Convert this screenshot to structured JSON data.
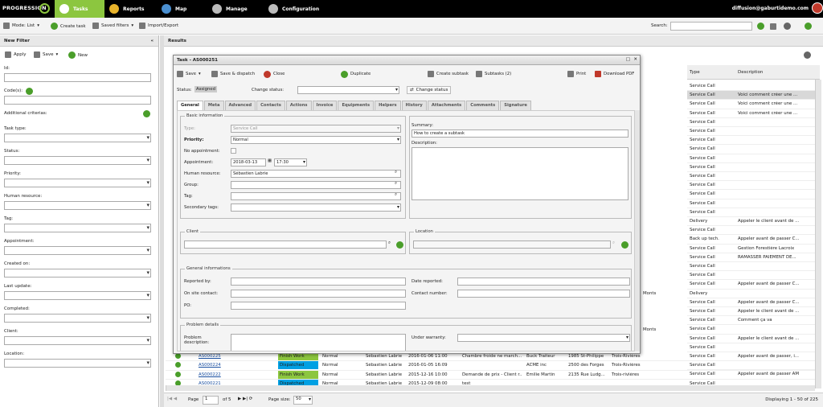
{
  "nav": {
    "logo": "PROGRESSION",
    "tabs": [
      "Tasks",
      "Reports",
      "Map",
      "Manage",
      "Configuration"
    ],
    "user": "diffusion@gaburtidemo.com"
  },
  "toolbar": {
    "mode": "Mode: List",
    "create": "Create task",
    "saved": "Saved filters",
    "import": "Import/Export",
    "search_label": "Search:"
  },
  "filter": {
    "title": "New Filter",
    "apply": "Apply",
    "save": "Save",
    "new": "New",
    "labels": [
      "Id:",
      "Code(s):",
      "Additional criterias:",
      "Task type:",
      "Status:",
      "Priority:",
      "Human resource:",
      "Tag:",
      "Appointment:",
      "Created on:",
      "Last update:",
      "Completed:",
      "Client:",
      "Location:"
    ]
  },
  "results": {
    "title": "Results",
    "col_type": "Type",
    "col_desc": "Description",
    "type_rows": [
      [
        "Service Call",
        ""
      ],
      [
        "Service Call",
        "Voici comment créer une ..."
      ],
      [
        "Service Call",
        "Voici comment créer une ..."
      ],
      [
        "Service Call",
        "Voici comment créer une ..."
      ],
      [
        "Service Call",
        ""
      ],
      [
        "Service Call",
        ""
      ],
      [
        "Service Call",
        ""
      ],
      [
        "Service Call",
        ""
      ],
      [
        "Service Call",
        ""
      ],
      [
        "Service Call",
        ""
      ],
      [
        "Service Call",
        ""
      ],
      [
        "Service Call",
        ""
      ],
      [
        "Service Call",
        ""
      ],
      [
        "Service Call",
        ""
      ],
      [
        "Service Call",
        ""
      ],
      [
        "Delivery",
        "Appeler le client avant de ..."
      ],
      [
        "Service Call",
        ""
      ],
      [
        "Back up tech.",
        "Appeler avant de passer C..."
      ],
      [
        "Service Call",
        "Gestion Forestière Lacroix"
      ],
      [
        "Service Call",
        "RAMASSER PAIEMENT DE..."
      ],
      [
        "Service Call",
        ""
      ],
      [
        "Service Call",
        ""
      ],
      [
        "Service Call",
        "Appeler avant de passer C..."
      ],
      [
        "Delivery",
        ""
      ],
      [
        "Service Call",
        "Appeler avant de passer C..."
      ],
      [
        "Service Call",
        "Appeler le client avant de ..."
      ],
      [
        "Service Call",
        "Comment ça va"
      ],
      [
        "Service Call",
        ""
      ],
      [
        "Service Call",
        "Appeler le client avant de ..."
      ],
      [
        "Service Call",
        ""
      ],
      [
        "Service Call",
        "Appeler avant de passer, i..."
      ],
      [
        "Service Call",
        ""
      ],
      [
        "Service Call",
        "Appeler avant de passer AM"
      ],
      [
        "Service Call",
        ""
      ]
    ],
    "frag1": "Monts",
    "frag2": "Monts",
    "bottom_rows": [
      {
        "code": "AS000225",
        "status": "Finish Work",
        "prio": "Normal",
        "res": "Sébastien Labrie",
        "date": "2016-01-06 11:00",
        "summary": "Chambre froide ne march...",
        "client": "Buck Traiteur",
        "addr": "1985 St-Philippe",
        "city": "Trois-Rivières"
      },
      {
        "code": "AS000224",
        "status": "Dispatched",
        "prio": "Normal",
        "res": "Sébastien Labrie",
        "date": "2016-01-05 16:09",
        "summary": "",
        "client": "ACME inc",
        "addr": "2500 des Forges",
        "city": "Trois-Rivières"
      },
      {
        "code": "AS000222",
        "status": "Finish Work",
        "prio": "Normal",
        "res": "Sébastien Labrie",
        "date": "2015-12-16 10:00",
        "summary": "Demande de prix - Client r...",
        "client": "Emilie Martin",
        "addr": "2135 Rue Ludg...",
        "city": "Trois-rivières"
      },
      {
        "code": "AS000221",
        "status": "Dispatched",
        "prio": "Normal",
        "res": "Sébastien Labrie",
        "date": "2015-12-09 08:00",
        "summary": "test",
        "client": "",
        "addr": "",
        "city": ""
      }
    ],
    "pager": {
      "page": "Page",
      "page_val": "1",
      "of": "of 5",
      "size_label": "Page size:",
      "size": "50",
      "displaying": "Displaying 1 - 50 of 225"
    }
  },
  "modal": {
    "title": "Task - AS000251",
    "tools": [
      "Save",
      "Save & dispatch",
      "Close",
      "Duplicate",
      "Create subtask",
      "Subtasks (2)",
      "Print",
      "Download PDF"
    ],
    "status_label": "Status:",
    "status": "Assigned",
    "change_label": "Change status:",
    "change_btn": "Change status",
    "tabs": [
      "General",
      "Meta",
      "Advanced",
      "Contacts",
      "Actions",
      "Invoice",
      "Equipments",
      "Helpers",
      "History",
      "Attachments",
      "Comments",
      "Signature"
    ],
    "basic": {
      "legend": "Basic information",
      "type_l": "Type:",
      "type_v": "Service Call",
      "prio_l": "Priority:",
      "prio_v": "Normal",
      "noappt_l": "No appointment:",
      "appt_l": "Appointment:",
      "appt_d": "2018-03-13",
      "appt_t": "17:30",
      "hr_l": "Human resource:",
      "hr_v": "Sébastien Labrie",
      "group_l": "Group:",
      "tag_l": "Tag:",
      "sec_l": "Secondary tags:",
      "summary_l": "Summary:",
      "summary_v": "How to create a subtask",
      "desc_l": "Description:"
    },
    "client_leg": "Client",
    "loc_leg": "Location",
    "gen": {
      "legend": "General informations",
      "rep_by": "Reported by:",
      "date_rep": "Date reported:",
      "onsite": "On site contact:",
      "contact_num": "Contact number:",
      "po": "PO:"
    },
    "prob": {
      "legend": "Problem details",
      "desc": "Problem description:",
      "warranty": "Under warranty:"
    }
  }
}
